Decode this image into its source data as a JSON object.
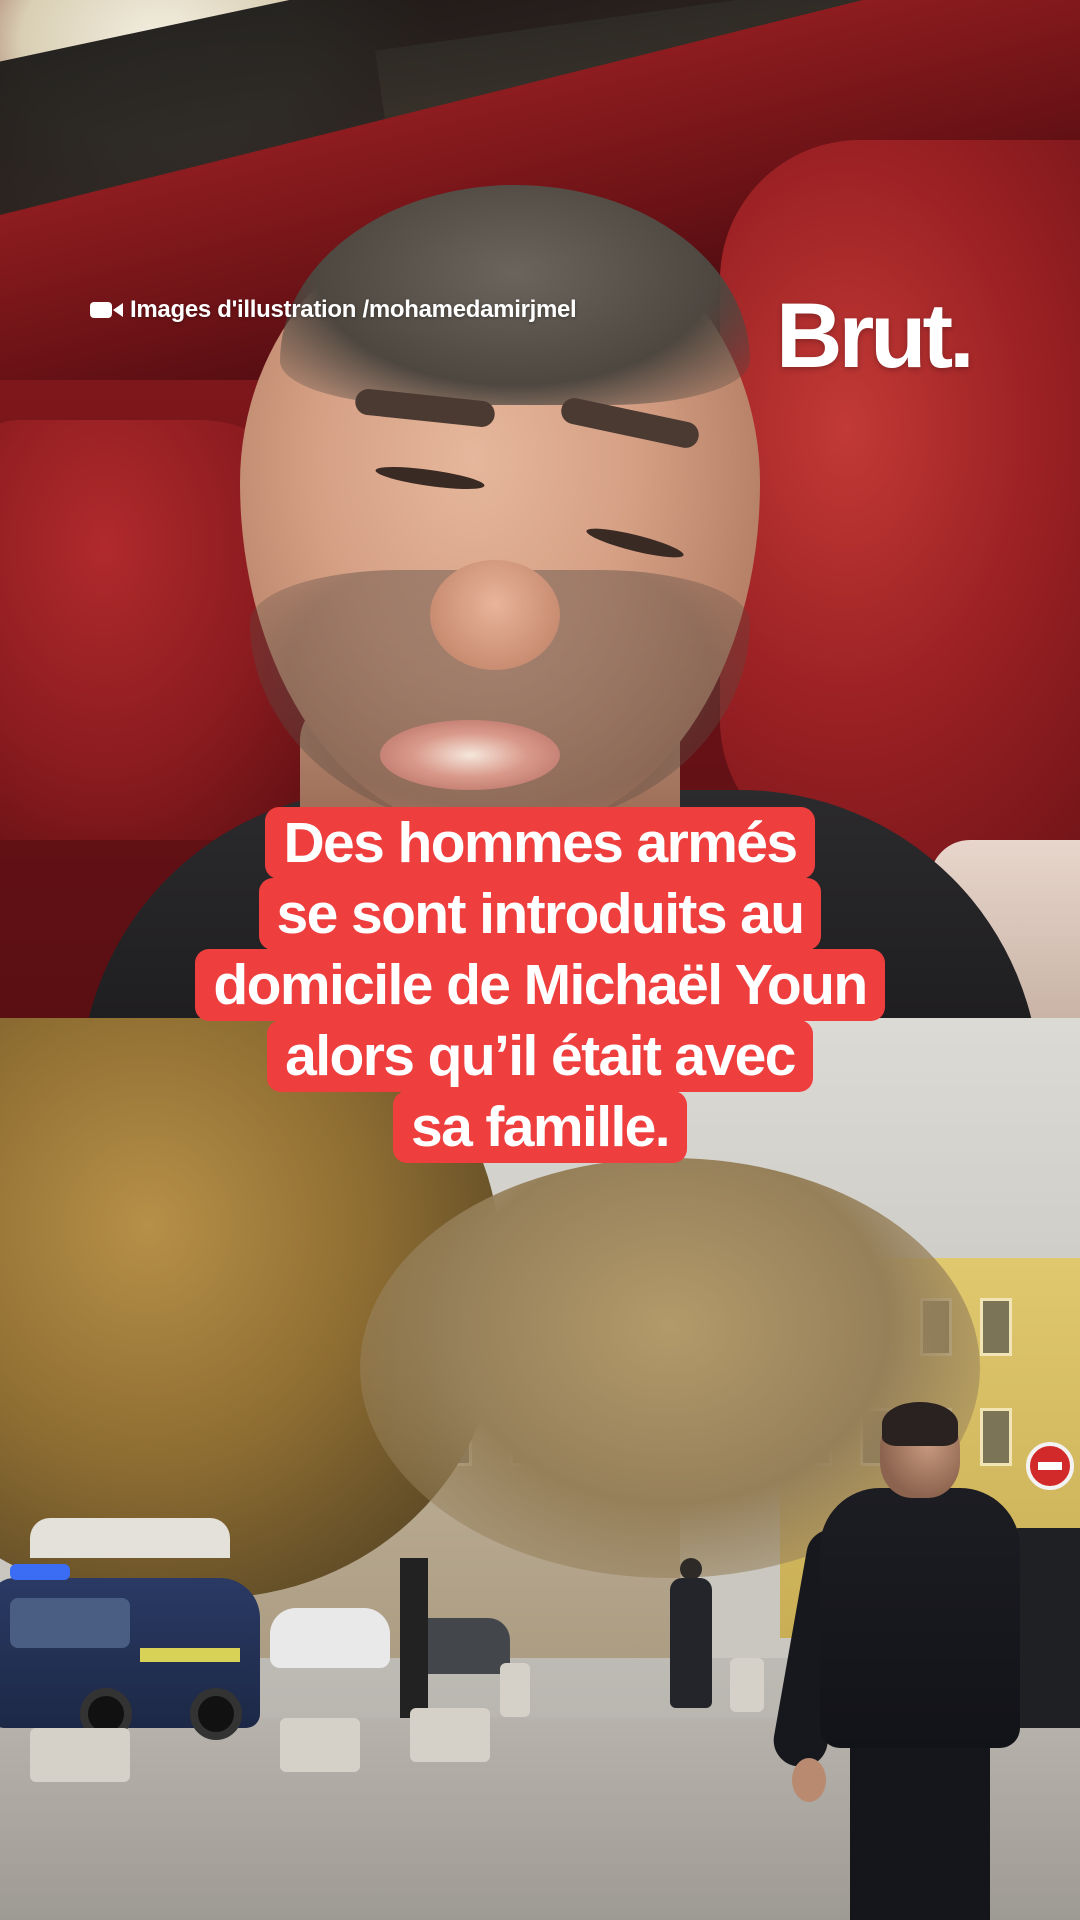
{
  "credit": {
    "icon": "video-camera-icon",
    "text": "Images d'illustration /mohamedamirjmel"
  },
  "brand": {
    "logo_text": "Brut."
  },
  "caption": {
    "background_color": "#ee3e3e",
    "text_color": "#ffffff",
    "lines": [
      "Des hommes armés",
      "se sont introduits au",
      "domicile de Michaël Youn",
      "alors qu’il était avec",
      "sa famille."
    ]
  }
}
